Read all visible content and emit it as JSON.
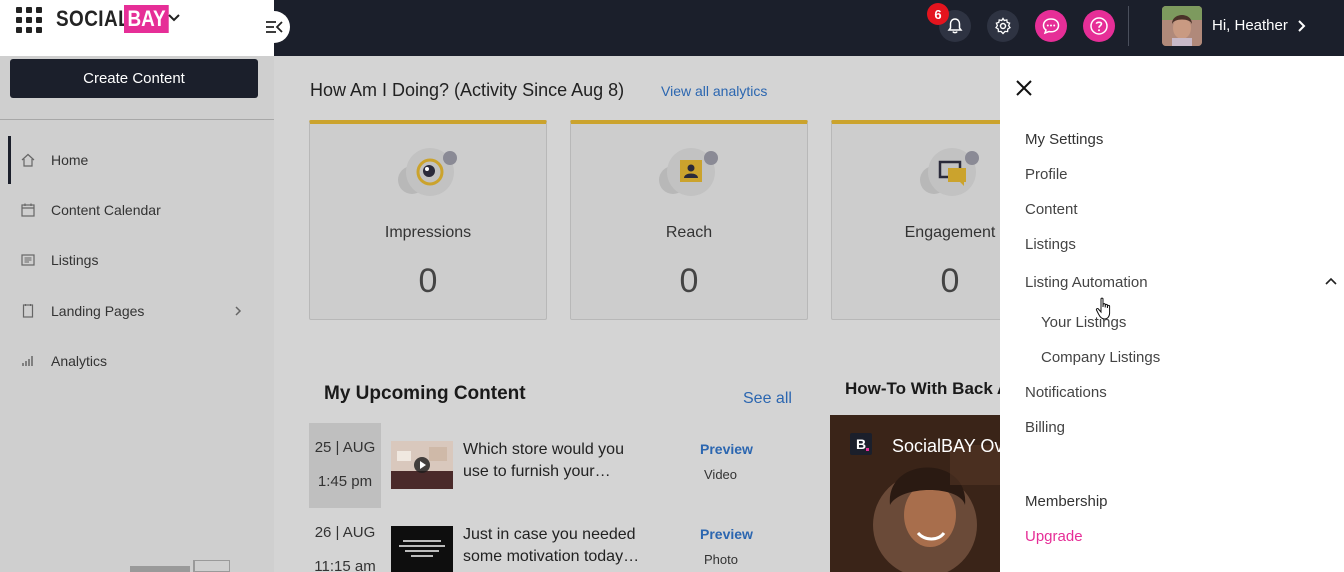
{
  "brand": {
    "word1": "SOCIAL",
    "word2": "BAY",
    "accent": "#e62e97",
    "dark": "#1b1f2b"
  },
  "topbar": {
    "notification_count": "6",
    "greeting": "Hi, Heather",
    "icons": [
      "bell-icon",
      "gear-icon",
      "chat-icon",
      "help-icon"
    ]
  },
  "sidebar": {
    "create_label": "Create Content",
    "items": [
      {
        "label": "Home",
        "icon": "home-icon"
      },
      {
        "label": "Content Calendar",
        "icon": "calendar-icon"
      },
      {
        "label": "Listings",
        "icon": "listings-icon"
      },
      {
        "label": "Landing Pages",
        "icon": "pages-icon"
      },
      {
        "label": "Analytics",
        "icon": "analytics-icon"
      }
    ]
  },
  "analytics": {
    "title": "How Am I Doing? (Activity Since Aug 8)",
    "link": "View all analytics",
    "stats": [
      {
        "label": "Impressions",
        "value": "0"
      },
      {
        "label": "Reach",
        "value": "0"
      },
      {
        "label": "Engagement",
        "value": "0"
      }
    ]
  },
  "upcoming": {
    "title": "My Upcoming Content",
    "see_all": "See all",
    "rows": [
      {
        "date": "25 | AUG",
        "time": "1:45 pm",
        "text": "Which store would you use to furnish your…",
        "action": "Preview",
        "type": "Video"
      },
      {
        "date": "26 | AUG",
        "time": "11:15 am",
        "text": "Just in case you needed some motivation today…",
        "action": "Preview",
        "type": "Photo"
      }
    ]
  },
  "howto": {
    "title": "How-To With Back A",
    "video_title": "SocialBAY Ov"
  },
  "settings": {
    "header": "My Settings",
    "items": [
      "Profile",
      "Content",
      "Listings"
    ],
    "automation": "Listing Automation",
    "sub_items": [
      "Your Listings",
      "Company Listings"
    ],
    "items2": [
      "Notifications",
      "Billing"
    ],
    "membership": "Membership",
    "upgrade": "Upgrade"
  }
}
